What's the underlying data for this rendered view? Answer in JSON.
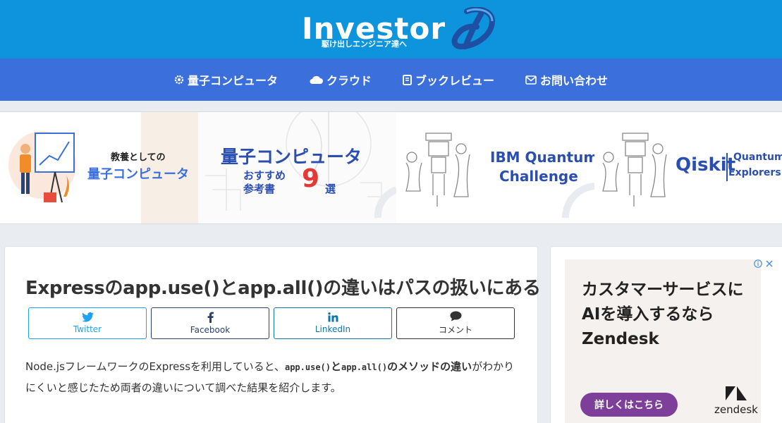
{
  "header": {
    "logo_text": "Investor",
    "logo_tagline": "駆け出しエンジニア達へ"
  },
  "nav": {
    "items": [
      {
        "label": "量子コンピュータ",
        "icon": "gear-icon"
      },
      {
        "label": "クラウド",
        "icon": "cloud-icon"
      },
      {
        "label": "ブックレビュー",
        "icon": "book-icon"
      },
      {
        "label": "お問い合わせ",
        "icon": "mail-icon"
      }
    ]
  },
  "banner": {
    "cards": [
      {
        "line1": "教養としての",
        "line2": "量子コンピュータ"
      },
      {
        "line1": "量子コンピュータ",
        "line2": "おすすめ",
        "line3": "参考書",
        "number": "9",
        "suffix": "選"
      },
      {
        "line1": "IBM Quantum",
        "line2": "Challenge"
      },
      {
        "line1": "Qiskit",
        "line2": "Quantum",
        "line3": "Explorers"
      }
    ]
  },
  "article": {
    "title": "Expressのapp.use()とapp.all()の違いはパスの扱いにある",
    "share": {
      "twitter": "Twitter",
      "facebook": "Facebook",
      "linkedin": "LinkedIn",
      "comment": "コメント"
    },
    "intro": {
      "part1": "Node.jsフレームワークのExpressを利用していると、",
      "code1": "app.use()",
      "and": "と",
      "code2": "app.all()",
      "bold": "のメソッドの違い",
      "part2": "がわかりにくいと感じたため両者の違いについて調べた結果を紹介します。"
    }
  },
  "ad": {
    "headline": "カスタマーサービスに\nAIを導入するなら\nZendesk",
    "button": "詳しくはこちら",
    "brand": "zendesk"
  },
  "colors": {
    "header_bg": "#0e94dc",
    "nav_bg": "#3a6fdc",
    "twitter": "#1da1f2",
    "facebook": "#2b4170",
    "linkedin": "#0e76a8",
    "ad_button": "#7d3f9a"
  }
}
